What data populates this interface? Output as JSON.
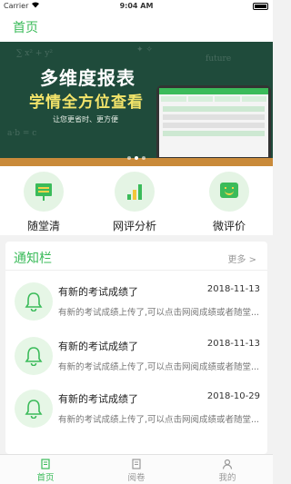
{
  "status_bar": {
    "carrier": "Carrier",
    "time": "9:04 AM"
  },
  "nav": {
    "title": "首页"
  },
  "banner": {
    "line1": "多维度报表",
    "line2": "学情全方位查看",
    "line3": "让您更省时、更方便",
    "slide_count": 3,
    "active_slide": 2
  },
  "quick_actions": [
    {
      "label": "随堂清",
      "icon": "blackboard-icon"
    },
    {
      "label": "网评分析",
      "icon": "bar-chart-icon"
    },
    {
      "label": "微评价",
      "icon": "smile-chat-icon"
    }
  ],
  "notice": {
    "title": "通知栏",
    "more": "更多 >",
    "items": [
      {
        "title": "有新的考试成绩了",
        "date": "2018-11-13",
        "desc": "有新的考试成绩上传了,可以点击网阅成绩或者随堂..."
      },
      {
        "title": "有新的考试成绩了",
        "date": "2018-11-13",
        "desc": "有新的考试成绩上传了,可以点击网阅成绩或者随堂..."
      },
      {
        "title": "有新的考试成绩了",
        "date": "2018-10-29",
        "desc": "有新的考试成绩上传了,可以点击网阅成绩或者随堂..."
      }
    ]
  },
  "tabs": [
    {
      "label": "首页",
      "icon": "home-icon",
      "active": true
    },
    {
      "label": "阅卷",
      "icon": "document-icon",
      "active": false
    },
    {
      "label": "我的",
      "icon": "person-icon",
      "active": false
    }
  ],
  "colors": {
    "accent": "#3bbb5a",
    "banner_bg": "#1f4b3b",
    "highlight": "#f3e46a"
  }
}
